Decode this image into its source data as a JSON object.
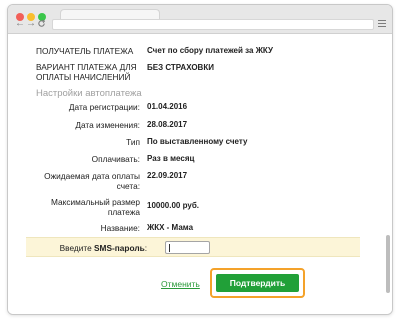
{
  "browser": {
    "nav_back": "←",
    "nav_forward": "→",
    "nav_reload": "C"
  },
  "rows": [
    {
      "label": "ПОЛУЧАТЕЛЬ ПЛАТЕЖА",
      "value": "Счет по сбору платежей за ЖКУ"
    },
    {
      "label": "ВАРИАНТ ПЛАТЕЖА ДЛЯ ОПЛАТЫ НАЧИСЛЕНИЙ",
      "value": "БЕЗ СТРАХОВКИ"
    }
  ],
  "autopay_section": {
    "title": "Настройки автоплатежа",
    "fields": [
      {
        "label": "Дата регистрации:",
        "value": "01.04.2016"
      },
      {
        "label": "Дата изменения:",
        "value": "28.08.2017"
      },
      {
        "label": "Тип",
        "value": "По выставленному счету"
      },
      {
        "label": "Оплачивать:",
        "value": "Раз в месяц"
      },
      {
        "label": "Ожидаемая дата оплаты счета:",
        "value": "22.09.2017"
      },
      {
        "label": "Максимальный размер платежа",
        "value": "10000.00 руб."
      },
      {
        "label": "Название:",
        "value": "ЖКХ - Мама"
      }
    ]
  },
  "sms": {
    "label_prefix": "Введите ",
    "label_bold": "SMS-пароль",
    "label_suffix": ":",
    "value": ""
  },
  "actions": {
    "cancel_label": "Отменить",
    "confirm_label": "Подтвердить"
  },
  "colors": {
    "primary_green": "#21a038",
    "focus_orange": "#f4a22a",
    "sms_highlight": "#fcf5d8"
  }
}
